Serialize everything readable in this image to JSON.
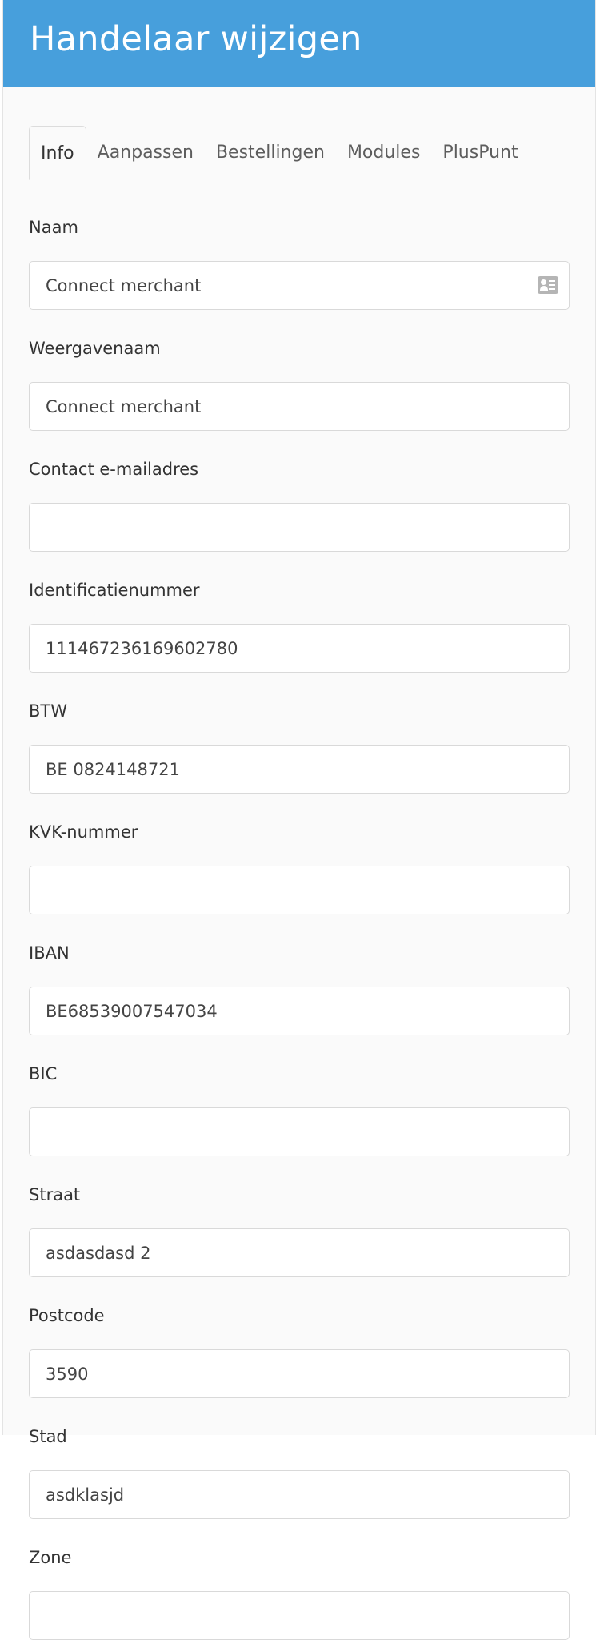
{
  "header": {
    "title": "Handelaar wijzigen"
  },
  "tabs": [
    {
      "label": "Info",
      "active": true
    },
    {
      "label": "Aanpassen",
      "active": false
    },
    {
      "label": "Bestellingen",
      "active": false
    },
    {
      "label": "Modules",
      "active": false
    },
    {
      "label": "PlusPunt",
      "active": false
    }
  ],
  "fields": {
    "naam": {
      "label": "Naam",
      "value": "Connect merchant",
      "icon": "contact-card-icon"
    },
    "weergavenaam": {
      "label": "Weergavenaam",
      "value": "Connect merchant"
    },
    "contact_email": {
      "label": "Contact e-mailadres",
      "value": ""
    },
    "identificatienummer": {
      "label": "Identificatienummer",
      "value": "111467236169602780"
    },
    "btw": {
      "label": "BTW",
      "value": "BE 0824148721"
    },
    "kvk": {
      "label": "KVK-nummer",
      "value": ""
    },
    "iban": {
      "label": "IBAN",
      "value": "BE68539007547034"
    },
    "bic": {
      "label": "BIC",
      "value": ""
    },
    "straat": {
      "label": "Straat",
      "value": "asdasdasd 2"
    },
    "postcode": {
      "label": "Postcode",
      "value": "3590"
    },
    "stad": {
      "label": "Stad",
      "value": "asdklasjd"
    },
    "zone": {
      "label": "Zone",
      "value": ""
    }
  },
  "colors": {
    "header_background": "#479fdc",
    "page_background": "#fafafa",
    "input_border": "#d9d9d9"
  }
}
